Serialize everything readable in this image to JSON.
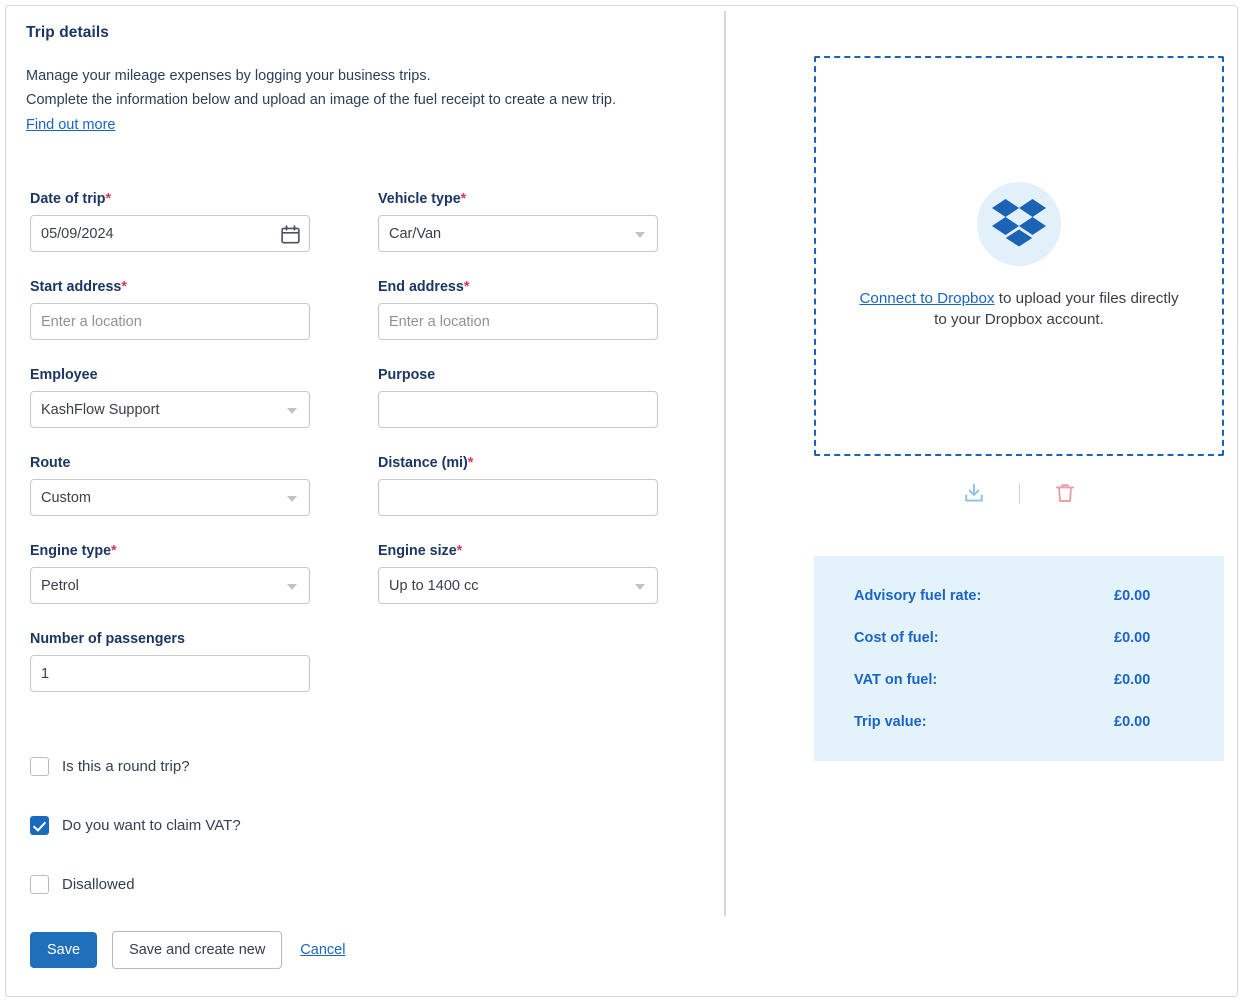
{
  "header": {
    "title": "Trip details",
    "intro_line1": "Manage your mileage expenses by logging your business trips.",
    "intro_line2": "Complete the information below and upload an image of the fuel receipt to create a new trip.",
    "find_out_more": "Find out more"
  },
  "fields": {
    "date_of_trip": {
      "label": "Date of trip",
      "required": "*",
      "value": "05/09/2024",
      "icon": "calendar-icon"
    },
    "vehicle_type": {
      "label": "Vehicle type",
      "required": "*",
      "value": "Car/Van"
    },
    "start_address": {
      "label": "Start address",
      "required": "*",
      "placeholder": "Enter a location",
      "value": ""
    },
    "end_address": {
      "label": "End address",
      "required": "*",
      "placeholder": "Enter a location",
      "value": ""
    },
    "employee": {
      "label": "Employee",
      "required": "",
      "value": "KashFlow Support"
    },
    "purpose": {
      "label": "Purpose",
      "required": "",
      "value": ""
    },
    "route": {
      "label": "Route",
      "required": "",
      "value": "Custom"
    },
    "distance": {
      "label": "Distance (mi)",
      "required": "*",
      "value": ""
    },
    "engine_type": {
      "label": "Engine type",
      "required": "*",
      "value": "Petrol"
    },
    "engine_size": {
      "label": "Engine size",
      "required": "*",
      "value": "Up to 1400 cc"
    },
    "passengers": {
      "label": "Number of passengers",
      "required": "",
      "value": "1"
    }
  },
  "checkboxes": [
    {
      "label": "Is this a round trip?",
      "checked": false
    },
    {
      "label": "Do you want to claim VAT?",
      "checked": true
    },
    {
      "label": "Disallowed",
      "checked": false
    }
  ],
  "actions": {
    "save": "Save",
    "save_and_create_new": "Save and create new",
    "cancel": "Cancel"
  },
  "upload": {
    "link_text": "Connect to Dropbox",
    "rest_text": " to upload your files directly to your Dropbox account.",
    "logo": "dropbox-logo-icon",
    "download_icon": "download-icon",
    "delete_icon": "trash-icon"
  },
  "summary": {
    "rows": [
      {
        "label": "Advisory fuel rate:",
        "amount": "£0.00"
      },
      {
        "label": "Cost of fuel:",
        "amount": "£0.00"
      },
      {
        "label": "VAT on fuel:",
        "amount": "£0.00"
      },
      {
        "label": "Trip value:",
        "amount": "£0.00"
      }
    ]
  },
  "colors": {
    "primary_blue": "#1f6fba",
    "link_blue": "#1a65c4",
    "label_navy": "#1c3664",
    "required_red": "#d6395c",
    "summary_bg": "#e4f2fb",
    "dropbox_blue": "#1c63b5",
    "delete_red": "#e8a0a8"
  }
}
